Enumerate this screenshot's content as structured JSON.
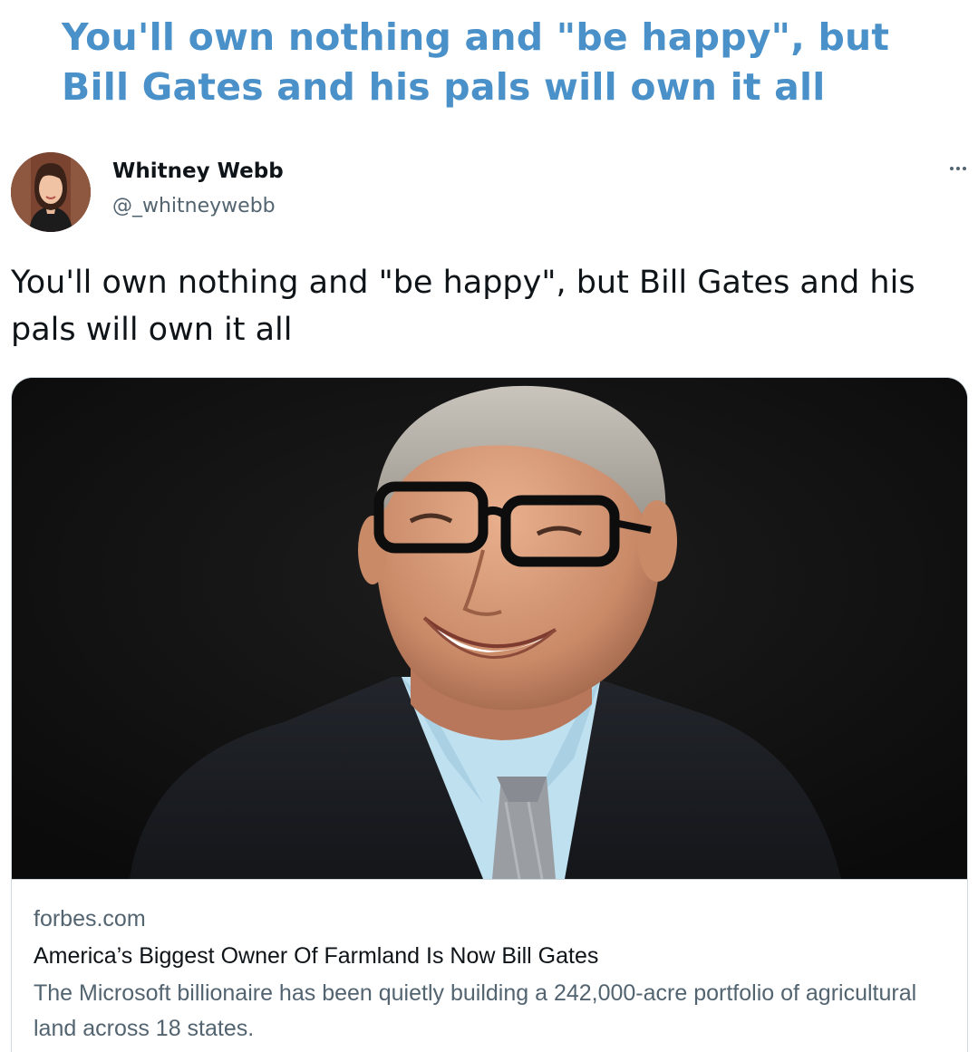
{
  "headline": "You'll own nothing and \"be happy\", but Bill Gates and his pals will own it all",
  "tweet": {
    "author": {
      "name": "Whitney Webb",
      "handle": "@_whitneywebb"
    },
    "more_icon": "more-horizontal-icon",
    "text": "You'll own nothing and \"be happy\", but Bill Gates and his pals will own it all",
    "card": {
      "domain": "forbes.com",
      "title": "America’s Biggest Owner Of Farmland Is Now Bill Gates",
      "description": "The Microsoft billionaire has been quietly building a 242,000-acre portfolio of agricultural land across 18 states."
    }
  },
  "colors": {
    "headline": "#4a90c9",
    "primary_text": "#0f1419",
    "secondary_text": "#536471",
    "border": "#cfd9de",
    "image_background": "#121212"
  }
}
